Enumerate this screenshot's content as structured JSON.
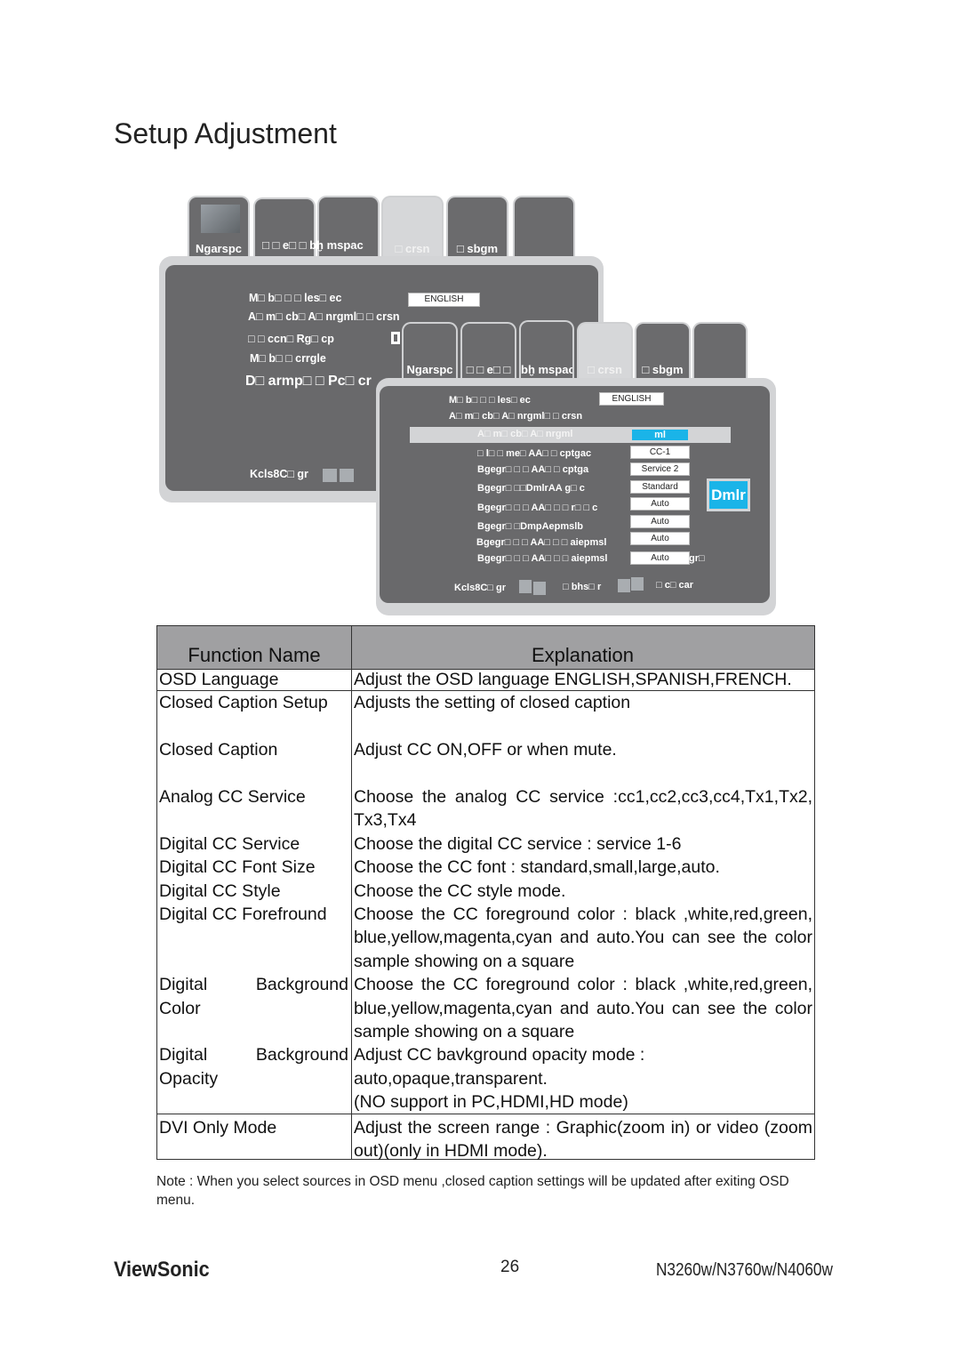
{
  "title": "Setup Adjustment",
  "osd_back": {
    "tabs": [
      "Ngarspc",
      "□ □ e□ □ bḫ mspac",
      "",
      "□ crsn",
      "□ sbgm",
      ""
    ],
    "selected_tab": 3,
    "items": [
      "M□ b□ □ □ les□ ec",
      "A□ m□ cb□ A□ nrgml□ □ crsn",
      "□ □ ccn□ Rg□ cp",
      "M□ b□ □ crrgle",
      "D□ armp□ □ Pc□ cr"
    ],
    "language_value": "ENGLISH",
    "footer": "Kcls8C□ gr"
  },
  "osd_front": {
    "tabs": [
      "Ngarspc",
      "□ □ e□ □",
      "bḫ mspac",
      "□ crsn",
      "□ sbgm",
      ""
    ],
    "selected_tab": 3,
    "items": [
      {
        "label": "M□ b□ □ □ les□ ec",
        "value": "ENGLISH"
      },
      {
        "label": "A□ m□ cb□ A□ nrgml□ □ crsn",
        "value": ""
      },
      {
        "label": "A□ m□ cb□ A□ nrgml",
        "value": "ml"
      },
      {
        "label": "□ l□ □ me□ AA□ □ cptgac",
        "value": "CC-1"
      },
      {
        "label": "Bgegr□ □ □ AA□ □ cptga",
        "value": "Service 2"
      },
      {
        "label": "Bgegr□ □□DmlrAA g□ c",
        "value": "Standard"
      },
      {
        "label": "Bgegr□ □ □ AA□ □ □ r□ □ c",
        "value": "Auto"
      },
      {
        "label": "Bgegr□ □DmpAepmslb",
        "value": "Auto"
      },
      {
        "label": "Bgegr□ □ □ AA□ □ □ aiepmsl",
        "value": "Auto"
      },
      {
        "label": "Bgegr□ □ □ AA□ □ □ aiepmsl",
        "value": "Auto"
      }
    ],
    "trailing": "gr□",
    "side_button": "Dmlr",
    "footer": [
      "Kcls8C□ gr",
      "□ bhs□ r",
      "□ c□ car"
    ],
    "highlight_color": "#1ab4e8"
  },
  "table": {
    "headers": [
      "Function Name",
      "Explanation"
    ],
    "rows": [
      {
        "name": [
          "OSD Language"
        ],
        "explanation": [
          "Adjust the OSD language  ENGLISH,SPANISH,FRENCH."
        ]
      },
      {
        "name": [
          "Closed Caption Setup"
        ],
        "explanation": [
          "Adjusts the setting of closed caption"
        ]
      },
      {
        "name": [
          "Closed Caption"
        ],
        "explanation": [
          "Adjust CC ON,OFF or when mute."
        ]
      },
      {
        "name": [
          "Analog CC Service"
        ],
        "explanation": [
          "Choose the analog CC service :cc1,cc2,cc3,cc4,Tx1,Tx2,",
          "Tx3,Tx4"
        ]
      },
      {
        "name": [
          "Digital CC Service"
        ],
        "explanation": [
          "Choose the digital CC service : service 1-6"
        ]
      },
      {
        "name": [
          "Digital CC Font Size"
        ],
        "explanation": [
          "Choose the CC font : standard,small,large,auto."
        ]
      },
      {
        "name": [
          "Digital CC Style"
        ],
        "explanation": [
          "Choose the CC style mode."
        ]
      },
      {
        "name": [
          "Digital CC Forefround"
        ],
        "explanation": [
          "Choose the CC foreground color : black ,white,red,green,",
          "blue,yellow,magenta,cyan and auto.You can see the color",
          "sample showing on a square"
        ]
      },
      {
        "name": [
          "Digital Background",
          "Color"
        ],
        "explanation": [
          "Choose the CC foreground color : black ,white,red,green,",
          "blue,yellow,magenta,cyan and auto.You can see the color",
          "sample showing on a square"
        ]
      },
      {
        "name": [
          "Digital Background",
          "Opacity"
        ],
        "explanation": [
          "Adjust CC bavkground opacity mode :",
          "auto,opaque,transparent.",
          "(NO support in PC,HDMI,HD mode)"
        ]
      },
      {
        "name": [
          "DVI Only Mode"
        ],
        "explanation": [
          "Adjust the screen range : Graphic(zoom in) or video (zoom",
          "out)(only in HDMI mode)."
        ]
      }
    ]
  },
  "note": "Note : When you select sources in OSD menu ,closed caption settings will be updated after exiting OSD menu.",
  "footer": {
    "brand": "ViewSonic",
    "page": "26",
    "model": "N3260w/N3760w/N4060w"
  }
}
